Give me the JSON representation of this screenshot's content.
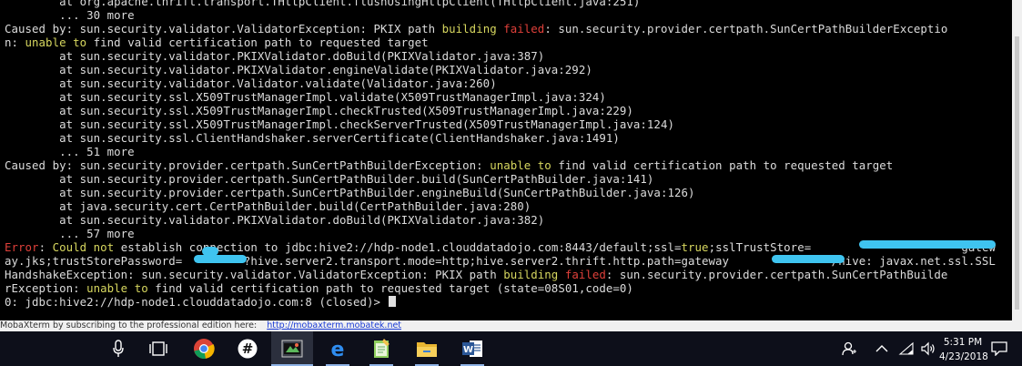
{
  "terminal": {
    "lines": [
      [
        {
          "t": "        at org.apache.thrift.transport.THttpClient.flushUsingHttpClient(THttpClient.java:251)",
          "c": "plain"
        }
      ],
      [
        {
          "t": "        ... 30 more",
          "c": "plain"
        }
      ],
      [
        {
          "t": "Caused by: sun.security.validator.ValidatorException: PKIX path ",
          "c": "plain"
        },
        {
          "t": "building",
          "c": "yellow"
        },
        {
          "t": " ",
          "c": "plain"
        },
        {
          "t": "failed",
          "c": "red"
        },
        {
          "t": ": sun.security.provider.certpath.SunCertPathBuilderExceptio",
          "c": "plain"
        }
      ],
      [
        {
          "t": "n: ",
          "c": "plain"
        },
        {
          "t": "unable",
          "c": "yellow"
        },
        {
          "t": " ",
          "c": "plain"
        },
        {
          "t": "to",
          "c": "yellow"
        },
        {
          "t": " find valid certification path to requested target",
          "c": "plain"
        }
      ],
      [
        {
          "t": "        at sun.security.validator.PKIXValidator.doBuild(PKIXValidator.java:387)",
          "c": "plain"
        }
      ],
      [
        {
          "t": "        at sun.security.validator.PKIXValidator.engineValidate(PKIXValidator.java:292)",
          "c": "plain"
        }
      ],
      [
        {
          "t": "        at sun.security.validator.Validator.validate(Validator.java:260)",
          "c": "plain"
        }
      ],
      [
        {
          "t": "        at sun.security.ssl.X509TrustManagerImpl.validate(X509TrustManagerImpl.java:324)",
          "c": "plain"
        }
      ],
      [
        {
          "t": "        at sun.security.ssl.X509TrustManagerImpl.checkTrusted(X509TrustManagerImpl.java:229)",
          "c": "plain"
        }
      ],
      [
        {
          "t": "        at sun.security.ssl.X509TrustManagerImpl.checkServerTrusted(X509TrustManagerImpl.java:124)",
          "c": "plain"
        }
      ],
      [
        {
          "t": "        at sun.security.ssl.ClientHandshaker.serverCertificate(ClientHandshaker.java:1491)",
          "c": "plain"
        }
      ],
      [
        {
          "t": "        ... 51 more",
          "c": "plain"
        }
      ],
      [
        {
          "t": "Caused by: sun.security.provider.certpath.SunCertPathBuilderException: ",
          "c": "plain"
        },
        {
          "t": "unable",
          "c": "yellow"
        },
        {
          "t": " ",
          "c": "plain"
        },
        {
          "t": "to",
          "c": "yellow"
        },
        {
          "t": " find valid certification path to requested target",
          "c": "plain"
        }
      ],
      [
        {
          "t": "        at sun.security.provider.certpath.SunCertPathBuilder.build(SunCertPathBuilder.java:141)",
          "c": "plain"
        }
      ],
      [
        {
          "t": "        at sun.security.provider.certpath.SunCertPathBuilder.engineBuild(SunCertPathBuilder.java:126)",
          "c": "plain"
        }
      ],
      [
        {
          "t": "        at java.security.cert.CertPathBuilder.build(CertPathBuilder.java:280)",
          "c": "plain"
        }
      ],
      [
        {
          "t": "        at sun.security.validator.PKIXValidator.doBuild(PKIXValidator.java:382)",
          "c": "plain"
        }
      ],
      [
        {
          "t": "        ... 57 more",
          "c": "plain"
        }
      ],
      [
        {
          "t": "Error",
          "c": "red"
        },
        {
          "t": ": ",
          "c": "plain"
        },
        {
          "t": "Could",
          "c": "yellow"
        },
        {
          "t": " ",
          "c": "plain"
        },
        {
          "t": "not",
          "c": "yellow"
        },
        {
          "t": " establish connection to jdbc:hive2://hdp-node1.clouddatadojo.com:8443/default;ssl=",
          "c": "plain"
        },
        {
          "t": "true",
          "c": "yellow"
        },
        {
          "t": ";sslTrustStore=                      gatew",
          "c": "plain"
        }
      ],
      [
        {
          "t": "ay.jks;trustStorePassword=         ?hive.server2.transport.mode=http;hive.server2.thrift.http.path=gateway               /hive: javax.net.ssl.SSL",
          "c": "plain"
        }
      ],
      [
        {
          "t": "HandshakeException: sun.security.validator.ValidatorException: PKIX path ",
          "c": "plain"
        },
        {
          "t": "building",
          "c": "yellow"
        },
        {
          "t": " ",
          "c": "plain"
        },
        {
          "t": "failed",
          "c": "red"
        },
        {
          "t": ": sun.security.provider.certpath.SunCertPathBuilde",
          "c": "plain"
        }
      ],
      [
        {
          "t": "rException: ",
          "c": "plain"
        },
        {
          "t": "unable",
          "c": "yellow"
        },
        {
          "t": " ",
          "c": "plain"
        },
        {
          "t": "to",
          "c": "yellow"
        },
        {
          "t": " find valid certification path to requested target (state=08S01,code=0)",
          "c": "plain"
        }
      ],
      [
        {
          "t": "0: jdbc:hive2://hdp-node1.clouddatadojo.com:8 (closed)> ",
          "c": "plain"
        }
      ]
    ]
  },
  "adbar": {
    "text": "MobaXterm by subscribing to the professional edition here:",
    "link": "http://mobaxterm.mobatek.net"
  },
  "taskbar": {
    "icons": [
      "microphone-icon",
      "task-view-icon",
      "chrome-icon",
      "slack-icon",
      "mobaxterm-icon",
      "edge-icon",
      "notepad-icon",
      "file-explorer-icon",
      "word-icon"
    ],
    "time": "5:31 PM",
    "date": "4/23/2018"
  },
  "colors": {
    "terminal_bg": "#000000",
    "text": "#dcdcdc",
    "keyword_yellow": "#d7d75f",
    "keyword_red": "#e0403a",
    "redaction": "#3fc4f0",
    "taskbar_bg": "#0d0f1a"
  }
}
